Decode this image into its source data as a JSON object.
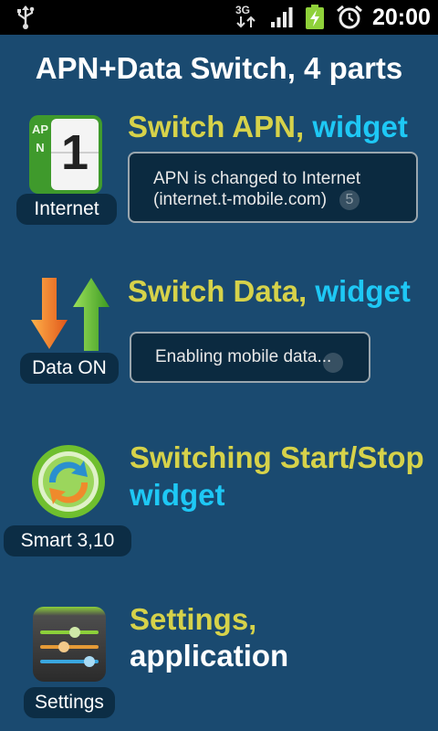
{
  "status_bar": {
    "network_type": "3G",
    "time": "20:00",
    "icons": [
      "usb-icon",
      "network-3g-icon",
      "signal-icon",
      "battery-charging-icon",
      "alarm-icon"
    ]
  },
  "title": "APN+Data Switch, 4 parts",
  "features": [
    {
      "icon": "apn-switch-icon",
      "icon_badge": "1",
      "icon_side_text": "APN",
      "label": "Internet",
      "heading_main": "Switch APN",
      "heading_sep": ", ",
      "heading_accent": "widget",
      "toast_lines": [
        "APN is changed to Internet",
        "(internet.t-mobile.com)"
      ]
    },
    {
      "icon": "data-switch-arrows-icon",
      "label": "Data ON",
      "heading_main": "Switch Data",
      "heading_sep": ", ",
      "heading_accent": "widget",
      "toast_lines": [
        "Enabling mobile data..."
      ]
    },
    {
      "icon": "smart-switching-icon",
      "label": "Smart 3,10",
      "heading_main": "Switching Start/Stop",
      "heading_accent": "widget"
    },
    {
      "icon": "settings-sliders-icon",
      "label": "Settings",
      "heading_main": "Settings,",
      "heading_accent": "application"
    }
  ],
  "colors": {
    "background": "#1a4a70",
    "heading_yellow": "#d6d24a",
    "accent_cyan": "#1ec8f5",
    "label_bg": "#0c2d45"
  }
}
